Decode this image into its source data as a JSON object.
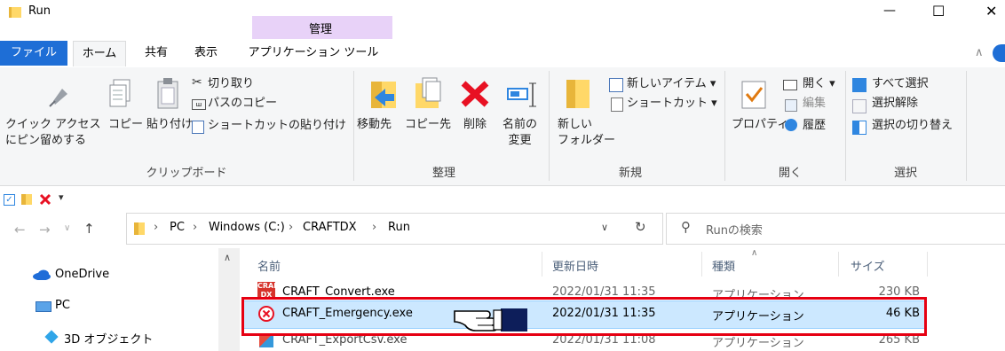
{
  "window": {
    "title": "Run",
    "context_tab": "管理",
    "controls": {
      "minimize": "—",
      "maximize": "☐",
      "close": "✕"
    }
  },
  "ribbon": {
    "tabs": [
      "ファイル",
      "ホーム",
      "共有",
      "表示",
      "アプリケーション ツール"
    ],
    "clipboard": {
      "pin_line1": "クイック アクセス",
      "pin_line2": "にピン留めする",
      "copy": "コピー",
      "paste": "貼り付け",
      "cut": "切り取り",
      "copy_path": "パスのコピー",
      "paste_shortcut": "ショートカットの貼り付け",
      "group": "クリップボード"
    },
    "organize": {
      "move_to": "移動先",
      "copy_to": "コピー先",
      "delete": "削除",
      "rename_line1": "名前の",
      "rename_line2": "変更",
      "group": "整理"
    },
    "new": {
      "new_folder_line1": "新しい",
      "new_folder_line2": "フォルダー",
      "new_item": "新しいアイテム ▾",
      "shortcut": "ショートカット ▾",
      "group": "新規"
    },
    "open": {
      "properties": "プロパティ",
      "open": "開く ▾",
      "edit": "編集",
      "history": "履歴",
      "group": "開く"
    },
    "select": {
      "select_all": "すべて選択",
      "select_none": "選択解除",
      "invert": "選択の切り替え",
      "group": "選択"
    }
  },
  "qat": {
    "dropdown": "▾"
  },
  "address": {
    "crumbs": [
      "PC",
      "Windows (C:)",
      "CRAFTDX",
      "Run"
    ],
    "separator": "›",
    "search_placeholder": "Runの検索"
  },
  "nav": {
    "items": [
      "OneDrive",
      "PC",
      "3D オブジェクト"
    ]
  },
  "list": {
    "headers": {
      "name": "名前",
      "date": "更新日時",
      "type": "種類",
      "size": "サイズ"
    },
    "rows": [
      {
        "name": "CRAFT_Convert.exe",
        "date": "2022/01/31 11:35",
        "type": "アプリケーション",
        "size": "230 KB"
      },
      {
        "name": "CRAFT_Emergency.exe",
        "date": "2022/01/31 11:35",
        "type": "アプリケーション",
        "size": "46 KB"
      },
      {
        "name": "CRAFT_ExportCsv.exe",
        "date": "2022/01/31 11:08",
        "type": "アプリケーション",
        "size": "265 KB"
      }
    ]
  },
  "colors": {
    "file_tab": "#1e6ed6",
    "context_tab": "#e8d2f8",
    "selection": "#cce8ff",
    "highlight_frame": "#e60012"
  }
}
